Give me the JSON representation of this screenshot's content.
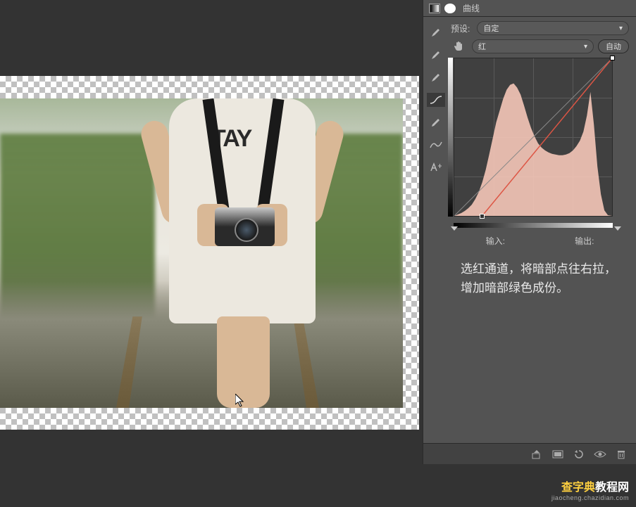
{
  "panel": {
    "title": "曲线",
    "preset_label": "预设:",
    "preset_value": "自定",
    "channel_value": "红",
    "auto_label": "自动",
    "input_label": "输入:",
    "output_label": "输出:"
  },
  "image": {
    "tshirt_text": "TAY"
  },
  "instruction_text": "选红通道，将暗部点往右拉，增加暗部绿色成份。",
  "watermark": {
    "brand_prefix": "查字典",
    "brand_suffix": "教程网",
    "url": "jiaocheng.chazidian.com"
  },
  "chart_data": {
    "type": "line",
    "title": "曲线 (红通道)",
    "xlabel": "输入",
    "ylabel": "输出",
    "xlim": [
      0,
      255
    ],
    "ylim": [
      0,
      255
    ],
    "series": [
      {
        "name": "baseline",
        "x": [
          0,
          255
        ],
        "y": [
          0,
          255
        ]
      },
      {
        "name": "red-curve",
        "x": [
          45,
          255
        ],
        "y": [
          0,
          255
        ]
      }
    ],
    "histogram_approx": [
      0,
      0,
      2,
      3,
      5,
      7,
      10,
      15,
      20,
      28,
      40,
      55,
      70,
      88,
      100,
      115,
      125,
      120,
      110,
      95,
      80,
      70,
      60,
      55,
      52,
      50,
      48,
      46,
      45,
      44,
      43,
      42,
      42,
      43,
      45,
      48,
      52,
      58,
      70,
      95,
      60,
      30,
      10,
      2,
      0
    ]
  }
}
